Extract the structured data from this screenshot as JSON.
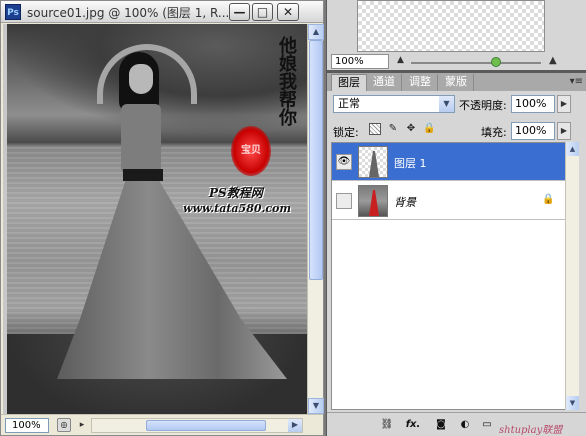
{
  "document": {
    "title": "source01.jpg @ 100% (图层 1, R...",
    "app_badge": "Ps",
    "zoom": "100%",
    "watermark_line1": "PS教程网",
    "watermark_line2": "www.tata580.com",
    "calligraphy": "他娘我帮你",
    "seal_text": "宝贝"
  },
  "window_buttons": {
    "minimize": "—",
    "maximize": "□",
    "close": "✕"
  },
  "navigator": {
    "zoom": "100%"
  },
  "tabs": [
    {
      "label": "图层"
    },
    {
      "label": "通道"
    },
    {
      "label": "调整"
    },
    {
      "label": "蒙版"
    }
  ],
  "layers_panel": {
    "blend_mode": "正常",
    "opacity_label": "不透明度:",
    "opacity_value": "100%",
    "lock_label": "锁定:",
    "fill_label": "填充:",
    "fill_value": "100%",
    "layers": [
      {
        "name": "图层 1",
        "visible": true,
        "selected": true
      },
      {
        "name": "背景",
        "visible": false,
        "selected": false,
        "locked": true
      }
    ],
    "bottom_icons": [
      "link-icon",
      "fx-icon",
      "mask-icon",
      "adjustment-icon",
      "group-icon",
      "new-layer-icon",
      "trash-icon"
    ],
    "fx_label": "fx.",
    "watermark": "shtuplay联盟"
  },
  "colors": {
    "selected_layer": "#3a6fd1",
    "panel_bg": "#d6d6d6",
    "seal_red": "#c80000"
  }
}
